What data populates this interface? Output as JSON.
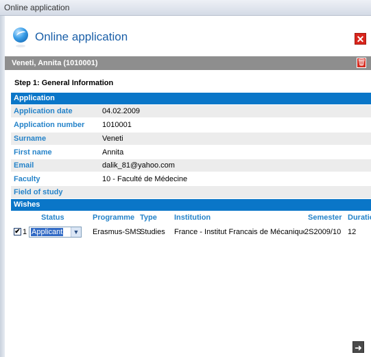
{
  "window": {
    "title": "Online application"
  },
  "header": {
    "title": "Online application",
    "close_icon": "close-icon"
  },
  "applicant": {
    "name_id": "Veneti, Annita (1010001)",
    "delete_icon": "trash-icon"
  },
  "step": "Step 1: General Information",
  "application": {
    "section_title": "Application",
    "fields": [
      {
        "label": "Application date",
        "value": "04.02.2009"
      },
      {
        "label": "Application number",
        "value": "1010001"
      },
      {
        "label": "Surname",
        "value": "Veneti"
      },
      {
        "label": "First name",
        "value": "Annita"
      },
      {
        "label": "Email",
        "value": "dalik_81@yahoo.com"
      },
      {
        "label": "Faculty",
        "value": "10 - Faculté de Médecine"
      },
      {
        "label": "Field of study",
        "value": ""
      }
    ]
  },
  "wishes": {
    "section_title": "Wishes",
    "columns": [
      "Status",
      "Programme",
      "Type",
      "Institution",
      "Semester",
      "Duratio"
    ],
    "rows": [
      {
        "checked": true,
        "check_mark": "✔",
        "number": "1",
        "status": "Applicant",
        "programme": "Erasmus-SMS",
        "type": "Studies",
        "institution": "France - Institut Francais de Mécanique A",
        "semester": "2S2009/10",
        "duration": "12"
      }
    ]
  },
  "footer": {
    "next_icon": "arrow-right-icon"
  },
  "colors": {
    "section_header": "#0a76c8",
    "label": "#2583c9",
    "userbar": "#8e8e8e",
    "close": "#d9251c"
  }
}
